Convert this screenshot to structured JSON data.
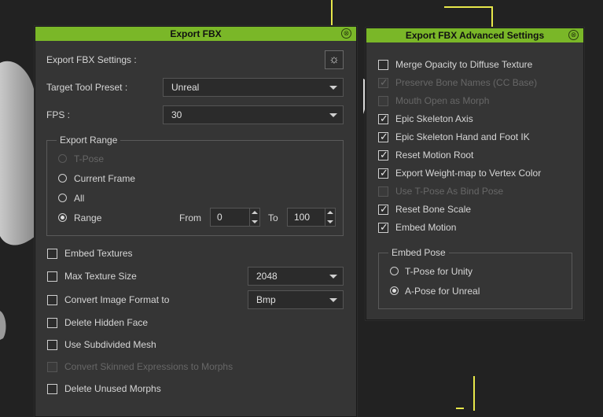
{
  "export_fbx": {
    "title": "Export FBX",
    "settings_label": "Export FBX Settings :",
    "target_preset_label": "Target Tool Preset :",
    "target_preset_value": "Unreal",
    "fps_label": "FPS :",
    "fps_value": "30",
    "export_range": {
      "title": "Export Range",
      "tpose": "T-Pose",
      "current_frame": "Current Frame",
      "all": "All",
      "range": "Range",
      "from_label": "From",
      "from_value": "0",
      "to_label": "To",
      "to_value": "100"
    },
    "embed_textures": "Embed Textures",
    "max_texture_size": "Max Texture Size",
    "max_texture_value": "2048",
    "convert_image_format": "Convert Image Format to",
    "image_format_value": "Bmp",
    "delete_hidden_face": "Delete Hidden Face",
    "use_subdivided_mesh": "Use Subdivided Mesh",
    "convert_skinned": "Convert Skinned Expressions to Morphs",
    "delete_unused_morphs": "Delete Unused Morphs"
  },
  "advanced": {
    "title": "Export FBX Advanced Settings",
    "items": [
      {
        "label": "Merge Opacity to Diffuse Texture",
        "checked": false,
        "disabled": false
      },
      {
        "label": "Preserve Bone Names (CC Base)",
        "checked": true,
        "disabled": true
      },
      {
        "label": "Mouth Open as Morph",
        "checked": false,
        "disabled": true
      },
      {
        "label": "Epic Skeleton Axis",
        "checked": true,
        "disabled": false
      },
      {
        "label": "Epic Skeleton Hand and Foot IK",
        "checked": true,
        "disabled": false
      },
      {
        "label": "Reset Motion Root",
        "checked": true,
        "disabled": false
      },
      {
        "label": "Export Weight-map to Vertex Color",
        "checked": true,
        "disabled": false
      },
      {
        "label": "Use T-Pose As Bind Pose",
        "checked": false,
        "disabled": true
      },
      {
        "label": "Reset Bone Scale",
        "checked": true,
        "disabled": false
      },
      {
        "label": "Embed Motion",
        "checked": true,
        "disabled": false
      }
    ],
    "embed_pose": {
      "title": "Embed Pose",
      "tpose_unity": "T-Pose for Unity",
      "apose_unreal": "A-Pose for Unreal"
    }
  },
  "icons": {
    "close": "⊗",
    "gear": "☼",
    "check": "✓"
  },
  "colors": {
    "title_bar": "#7ab728",
    "panel_bg": "#353535",
    "background": "#222222"
  }
}
